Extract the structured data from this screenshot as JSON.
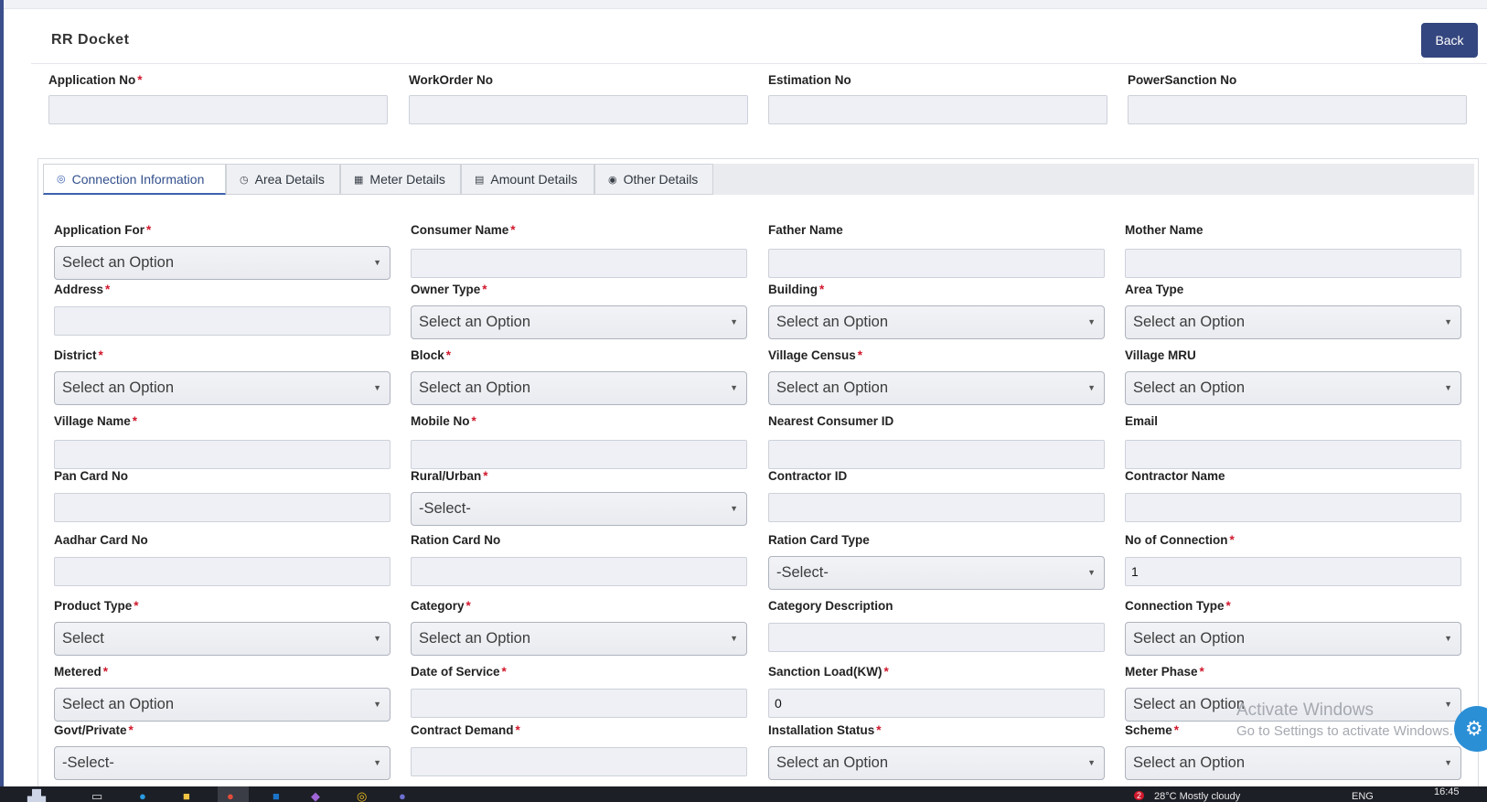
{
  "header": {
    "title": "RR Docket",
    "back_label": "Back"
  },
  "top_fields": [
    {
      "label": "Application No",
      "required": "*"
    },
    {
      "label": "WorkOrder No",
      "required": ""
    },
    {
      "label": "Estimation No",
      "required": ""
    },
    {
      "label": "PowerSanction No",
      "required": ""
    }
  ],
  "tabs": [
    {
      "label": "Connection Information",
      "icon": "target-icon",
      "glyph": "◎"
    },
    {
      "label": "Area Details",
      "icon": "clock-icon",
      "glyph": "◷"
    },
    {
      "label": "Meter Details",
      "icon": "meter-icon",
      "glyph": "▦"
    },
    {
      "label": "Amount Details",
      "icon": "bill-icon",
      "glyph": "▤"
    },
    {
      "label": "Other Details",
      "icon": "settings-icon",
      "glyph": "◉"
    }
  ],
  "form_rows": [
    [
      {
        "label": "Application For",
        "required": "*",
        "kind": "select",
        "value": "Select an Option"
      },
      {
        "label": "Consumer Name",
        "required": "*",
        "kind": "input",
        "value": ""
      },
      {
        "label": "Father Name",
        "required": "",
        "kind": "input",
        "value": ""
      },
      {
        "label": "Mother Name",
        "required": "",
        "kind": "input",
        "value": ""
      }
    ],
    [
      {
        "label": "Address",
        "required": "*",
        "kind": "input",
        "value": ""
      },
      {
        "label": "Owner Type",
        "required": "*",
        "kind": "select",
        "value": "Select an Option"
      },
      {
        "label": "Building",
        "required": "*",
        "kind": "select",
        "value": "Select an Option"
      },
      {
        "label": "Area Type",
        "required": "",
        "kind": "select",
        "value": "Select an Option"
      }
    ],
    [
      {
        "label": "District",
        "required": "*",
        "kind": "select",
        "value": "Select an Option"
      },
      {
        "label": "Block",
        "required": "*",
        "kind": "select",
        "value": "Select an Option"
      },
      {
        "label": "Village Census",
        "required": "*",
        "kind": "select",
        "value": "Select an Option"
      },
      {
        "label": "Village MRU",
        "required": "",
        "kind": "select",
        "value": "Select an Option"
      }
    ],
    [
      {
        "label": "Village Name",
        "required": "*",
        "kind": "input",
        "value": ""
      },
      {
        "label": "Mobile No",
        "required": "*",
        "kind": "input",
        "value": ""
      },
      {
        "label": "Nearest Consumer ID",
        "required": "",
        "kind": "input",
        "value": ""
      },
      {
        "label": "Email",
        "required": "",
        "kind": "input",
        "value": ""
      }
    ],
    [
      {
        "label": "Pan Card No",
        "required": "",
        "kind": "input",
        "value": ""
      },
      {
        "label": "Rural/Urban",
        "required": "*",
        "kind": "select",
        "value": "-Select-"
      },
      {
        "label": "Contractor ID",
        "required": "",
        "kind": "input",
        "value": ""
      },
      {
        "label": "Contractor Name",
        "required": "",
        "kind": "input",
        "value": ""
      }
    ],
    [
      {
        "label": "Aadhar Card No",
        "required": "",
        "kind": "input",
        "value": ""
      },
      {
        "label": "Ration Card No",
        "required": "",
        "kind": "input",
        "value": ""
      },
      {
        "label": "Ration Card Type",
        "required": "",
        "kind": "select",
        "value": "-Select-"
      },
      {
        "label": "No of Connection",
        "required": "*",
        "kind": "input",
        "value": "1"
      }
    ],
    [
      {
        "label": "Product Type",
        "required": "*",
        "kind": "select",
        "value": "Select"
      },
      {
        "label": "Category",
        "required": "*",
        "kind": "select",
        "value": "Select an Option"
      },
      {
        "label": "Category Description",
        "required": "",
        "kind": "input",
        "value": ""
      },
      {
        "label": "Connection Type",
        "required": "*",
        "kind": "select",
        "value": "Select an Option"
      }
    ],
    [
      {
        "label": "Metered",
        "required": "*",
        "kind": "select",
        "value": "Select an Option"
      },
      {
        "label": "Date of Service",
        "required": "*",
        "kind": "input",
        "value": ""
      },
      {
        "label": "Sanction Load(KW)",
        "required": "*",
        "kind": "input",
        "value": "0"
      },
      {
        "label": "Meter Phase",
        "required": "*",
        "kind": "select",
        "value": "Select an Option"
      }
    ],
    [
      {
        "label": "Govt/Private",
        "required": "*",
        "kind": "select",
        "value": "-Select-"
      },
      {
        "label": "Contract Demand",
        "required": "*",
        "kind": "input",
        "value": ""
      },
      {
        "label": "Installation Status",
        "required": "*",
        "kind": "select",
        "value": "Select an Option"
      },
      {
        "label": "Scheme",
        "required": "*",
        "kind": "select",
        "value": "Select an Option"
      }
    ]
  ],
  "overlay": {
    "activate_title": "Activate Windows",
    "activate_sub": "Go to Settings to activate Windows."
  },
  "taskbar": {
    "time": "16:45",
    "weather": "28°C  Mostly cloudy",
    "lang": "ENG",
    "notification_count": "2"
  },
  "colors": {
    "accent": "#34467f",
    "required": "#d0182c",
    "tab_active": "#3c61ad"
  }
}
